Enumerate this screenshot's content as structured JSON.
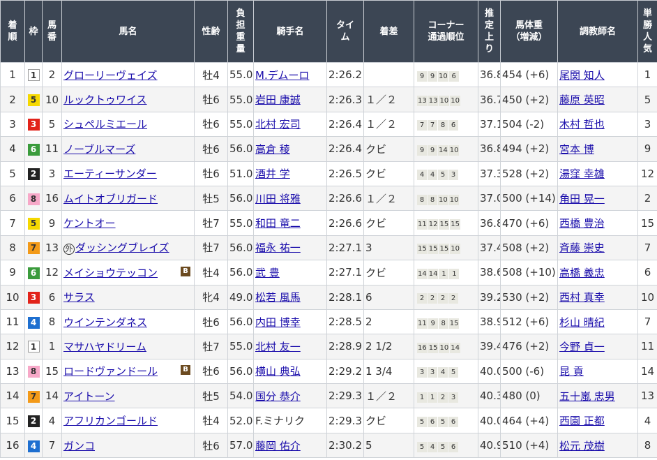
{
  "headers": {
    "rank": "着順",
    "waku": "枠",
    "umaban": "馬番",
    "name": "馬名",
    "sexage": "性齢",
    "weight": "負担重量",
    "jockey": "騎手名",
    "time": "タイム",
    "margin": "着差",
    "corner": "コーナー通過順位",
    "last3f": "推定上り",
    "body": "馬体重（増減）",
    "trainer": "調教師名",
    "pop": "単勝人気"
  },
  "waku_colors": {
    "1": {
      "bg": "#ffffff",
      "fg": "#333333"
    },
    "2": {
      "bg": "#222222",
      "fg": "#ffffff"
    },
    "3": {
      "bg": "#e2231a",
      "fg": "#ffffff"
    },
    "4": {
      "bg": "#1e6fd0",
      "fg": "#ffffff"
    },
    "5": {
      "bg": "#f5d800",
      "fg": "#333333"
    },
    "6": {
      "bg": "#3a9b3c",
      "fg": "#ffffff"
    },
    "7": {
      "bg": "#f39a19",
      "fg": "#333333"
    },
    "8": {
      "bg": "#f7a8c8",
      "fg": "#333333"
    }
  },
  "rows": [
    {
      "rank": "1",
      "waku": "1",
      "umaban": "2",
      "name": "グローリーヴェイズ",
      "prefix": "",
      "blinker": false,
      "sexage": "牡4",
      "weight": "55.0",
      "jockey": "M.デムーロ",
      "jockey_link": true,
      "time": "2:26.2",
      "margin": "",
      "corner": [
        "9",
        "9",
        "10",
        "6"
      ],
      "last3f": "36.8",
      "body": "454 (+6)",
      "trainer": "尾関 知人",
      "pop": "1"
    },
    {
      "rank": "2",
      "waku": "5",
      "umaban": "10",
      "name": "ルックトゥワイス",
      "prefix": "",
      "blinker": false,
      "sexage": "牡6",
      "weight": "55.0",
      "jockey": "岩田 康誠",
      "jockey_link": true,
      "time": "2:26.3",
      "margin": "１／２",
      "corner": [
        "13",
        "13",
        "10",
        "10"
      ],
      "last3f": "36.7",
      "body": "450 (+2)",
      "trainer": "藤原 英昭",
      "pop": "5"
    },
    {
      "rank": "3",
      "waku": "3",
      "umaban": "5",
      "name": "シュペルミエール",
      "prefix": "",
      "blinker": false,
      "sexage": "牡6",
      "weight": "55.0",
      "jockey": "北村 宏司",
      "jockey_link": true,
      "time": "2:26.4",
      "margin": "１／２",
      "corner": [
        "7",
        "7",
        "8",
        "6"
      ],
      "last3f": "37.1",
      "body": "504 (-2)",
      "trainer": "木村 哲也",
      "pop": "3"
    },
    {
      "rank": "4",
      "waku": "6",
      "umaban": "11",
      "name": "ノーブルマーズ",
      "prefix": "",
      "blinker": false,
      "sexage": "牡6",
      "weight": "56.0",
      "jockey": "高倉 稜",
      "jockey_link": true,
      "time": "2:26.4",
      "margin": "クビ",
      "corner": [
        "9",
        "9",
        "14",
        "10"
      ],
      "last3f": "36.8",
      "body": "494 (+2)",
      "trainer": "宮本 博",
      "pop": "9"
    },
    {
      "rank": "5",
      "waku": "2",
      "umaban": "3",
      "name": "エーティーサンダー",
      "prefix": "",
      "blinker": false,
      "sexage": "牡6",
      "weight": "51.0",
      "jockey": "酒井 学",
      "jockey_link": true,
      "time": "2:26.5",
      "margin": "クビ",
      "corner": [
        "4",
        "4",
        "5",
        "3"
      ],
      "last3f": "37.3",
      "body": "528 (+2)",
      "trainer": "湯窪 幸雄",
      "pop": "12"
    },
    {
      "rank": "6",
      "waku": "8",
      "umaban": "16",
      "name": "ムイトオブリガード",
      "prefix": "",
      "blinker": false,
      "sexage": "牡5",
      "weight": "56.0",
      "jockey": "川田 将雅",
      "jockey_link": true,
      "time": "2:26.6",
      "margin": "１／２",
      "corner": [
        "8",
        "8",
        "10",
        "10"
      ],
      "last3f": "37.0",
      "body": "500 (+14)",
      "trainer": "角田 晃一",
      "pop": "2"
    },
    {
      "rank": "7",
      "waku": "5",
      "umaban": "9",
      "name": "ケントオー",
      "prefix": "",
      "blinker": false,
      "sexage": "牡7",
      "weight": "55.0",
      "jockey": "和田 竜二",
      "jockey_link": true,
      "time": "2:26.6",
      "margin": "クビ",
      "corner": [
        "11",
        "12",
        "15",
        "15"
      ],
      "last3f": "36.8",
      "body": "470 (+6)",
      "trainer": "西橋 豊治",
      "pop": "15"
    },
    {
      "rank": "8",
      "waku": "7",
      "umaban": "13",
      "name": "ダッシングブレイズ",
      "prefix": "外",
      "blinker": false,
      "sexage": "牡7",
      "weight": "56.0",
      "jockey": "福永 祐一",
      "jockey_link": true,
      "time": "2:27.1",
      "margin": "3",
      "corner": [
        "15",
        "15",
        "15",
        "10"
      ],
      "last3f": "37.4",
      "body": "508 (+2)",
      "trainer": "斉藤 崇史",
      "pop": "7"
    },
    {
      "rank": "9",
      "waku": "6",
      "umaban": "12",
      "name": "メイショウテッコン",
      "prefix": "",
      "blinker": true,
      "sexage": "牡4",
      "weight": "56.0",
      "jockey": "武 豊",
      "jockey_link": true,
      "time": "2:27.1",
      "margin": "クビ",
      "corner": [
        "14",
        "14",
        "1",
        "1"
      ],
      "last3f": "38.6",
      "body": "508 (+10)",
      "trainer": "高橋 義忠",
      "pop": "6"
    },
    {
      "rank": "10",
      "waku": "3",
      "umaban": "6",
      "name": "サラス",
      "prefix": "",
      "blinker": false,
      "sexage": "牝4",
      "weight": "49.0",
      "jockey": "松若 風馬",
      "jockey_link": true,
      "time": "2:28.1",
      "margin": "6",
      "corner": [
        "2",
        "2",
        "2",
        "2"
      ],
      "last3f": "39.2",
      "body": "530 (+2)",
      "trainer": "西村 真幸",
      "pop": "10"
    },
    {
      "rank": "11",
      "waku": "4",
      "umaban": "8",
      "name": "ウインテンダネス",
      "prefix": "",
      "blinker": false,
      "sexage": "牡6",
      "weight": "56.0",
      "jockey": "内田 博幸",
      "jockey_link": true,
      "time": "2:28.5",
      "margin": "2",
      "corner": [
        "11",
        "9",
        "8",
        "15"
      ],
      "last3f": "38.9",
      "body": "512 (+6)",
      "trainer": "杉山 晴紀",
      "pop": "7"
    },
    {
      "rank": "12",
      "waku": "1",
      "umaban": "1",
      "name": "マサハヤドリーム",
      "prefix": "",
      "blinker": false,
      "sexage": "牡7",
      "weight": "55.0",
      "jockey": "北村 友一",
      "jockey_link": true,
      "time": "2:28.9",
      "margin": "2 1/2",
      "corner": [
        "16",
        "15",
        "10",
        "14"
      ],
      "last3f": "39.4",
      "body": "476 (+2)",
      "trainer": "今野 貞一",
      "pop": "11"
    },
    {
      "rank": "13",
      "waku": "8",
      "umaban": "15",
      "name": "ロードヴァンドール",
      "prefix": "",
      "blinker": true,
      "sexage": "牡6",
      "weight": "56.0",
      "jockey": "横山 典弘",
      "jockey_link": true,
      "time": "2:29.2",
      "margin": "1 3/4",
      "corner": [
        "3",
        "3",
        "4",
        "5"
      ],
      "last3f": "40.0",
      "body": "500 (-6)",
      "trainer": "昆 貢",
      "pop": "14"
    },
    {
      "rank": "14",
      "waku": "7",
      "umaban": "14",
      "name": "アイトーン",
      "prefix": "",
      "blinker": false,
      "sexage": "牡5",
      "weight": "54.0",
      "jockey": "国分 恭介",
      "jockey_link": true,
      "time": "2:29.3",
      "margin": "１／２",
      "corner": [
        "1",
        "1",
        "2",
        "3"
      ],
      "last3f": "40.3",
      "body": "480 (0)",
      "trainer": "五十嵐 忠男",
      "pop": "13"
    },
    {
      "rank": "15",
      "waku": "2",
      "umaban": "4",
      "name": "アフリカンゴールド",
      "prefix": "",
      "blinker": false,
      "sexage": "牡4",
      "weight": "52.0",
      "jockey": "F.ミナリク",
      "jockey_link": false,
      "time": "2:29.3",
      "margin": "クビ",
      "corner": [
        "5",
        "6",
        "5",
        "6"
      ],
      "last3f": "40.0",
      "body": "464 (+4)",
      "trainer": "西園 正都",
      "pop": "4"
    },
    {
      "rank": "16",
      "waku": "4",
      "umaban": "7",
      "name": "ガンコ",
      "prefix": "",
      "blinker": false,
      "sexage": "牡6",
      "weight": "57.0",
      "jockey": "藤岡 佑介",
      "jockey_link": true,
      "time": "2:30.2",
      "margin": "5",
      "corner": [
        "5",
        "4",
        "5",
        "6"
      ],
      "last3f": "40.9",
      "body": "510 (+4)",
      "trainer": "松元 茂樹",
      "pop": "8"
    }
  ],
  "blinker_mark": "B"
}
